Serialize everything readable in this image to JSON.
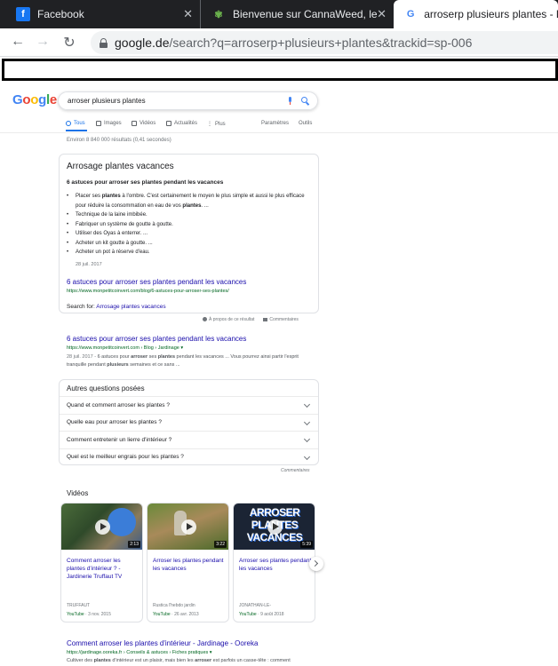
{
  "browser": {
    "tabs": [
      {
        "label": "Facebook",
        "icon": "facebook-icon"
      },
      {
        "label": "Bienvenue sur CannaWeed, le site",
        "icon": "cannabis-leaf-icon"
      },
      {
        "label": "arroserp plusieurs plantes - Rec",
        "icon": "google-icon"
      }
    ],
    "url_domain": "google.de",
    "url_path": "/search?q=arroserp+plusieurs+plantes&trackid=sp-006"
  },
  "google": {
    "logo_letters": [
      "G",
      "o",
      "o",
      "g",
      "l",
      "e"
    ],
    "query": "arroser plusieurs plantes",
    "tabs": [
      "Tous",
      "Images",
      "Vidéos",
      "Actualités",
      "Plus",
      "Paramètres",
      "Outils"
    ],
    "stats": "Environ 8 840 000 résultats (0,41 secondes)"
  },
  "snippet": {
    "title": "Arrosage plantes vacances",
    "heading": "6 astuces pour arroser ses plantes pendant les vacances",
    "items": [
      {
        "pre": "Placer ses ",
        "b1": "plantes",
        "mid": " à l'ombre. C'est certainement le moyen le plus simple et aussi le plus efficace pour réduire la consommation en eau de vos ",
        "b2": "plantes",
        "post": ". ..."
      },
      {
        "text": "Technique de la laine imbibée."
      },
      {
        "text": "Fabriquer un système de goutte à goutte."
      },
      {
        "text": "Utiliser des Oyas à enterrer. ..."
      },
      {
        "text": "Acheter un kit goutte à goutte. ..."
      },
      {
        "text": "Acheter un pot à réserve d'eau."
      }
    ],
    "date": "28 juil. 2017",
    "link": "6 astuces pour arroser ses plantes pendant les vacances",
    "url": "https://www.monpetitcoinvert.com/blog/6-astuces-pour-arroser-ses-plantes/",
    "search_for_label": "Search for: ",
    "search_for_link": "Arrosage plantes vacances",
    "about": "À propos de ce résultat",
    "comments": "Commentaires"
  },
  "result1": {
    "title": "6 astuces pour arroser ses plantes pendant les vacances",
    "url": "https://www.monpetitcoinvert.com › Blog › Jardinage ▾",
    "date": "28 juil. 2017 - ",
    "s1": "6 astuces pour ",
    "b1": "arroser",
    "s2": " ses ",
    "b2": "plantes",
    "s3": " pendant les vacances ... Vous pourrez ainsi partir l'esprit tranquille pendant ",
    "b3": "plusieurs",
    "s4": " semaines et ce sans ..."
  },
  "paa": {
    "title": "Autres questions posées",
    "questions": [
      "Quand et comment arroser les plantes ?",
      "Quelle eau pour arroser les plantes ?",
      "Comment entretenir un lierre d'intérieur ?",
      "Quel est le meilleur engrais pour les plantes ?"
    ],
    "footer": "Commentaires"
  },
  "videos": {
    "heading": "Vidéos",
    "items": [
      {
        "title": "Comment arroser les plantes d'intérieur ? - Jardinerie Truffaut TV",
        "duration": "2:13",
        "channel": "TRUFFAUT",
        "source": "YouTube",
        "date": " · 3 nov. 2015"
      },
      {
        "title": "Arroser les plantes pendant les vacances",
        "duration": "3:22",
        "channel": "Rustica l'hebdo jardin",
        "source": "YouTube",
        "date": " · 26 avr. 2013"
      },
      {
        "title": "Arroser ses plantes pendant les vacances",
        "duration": "5:39",
        "channel": "JONATHAN-LE-",
        "source": "YouTube",
        "date": " · 9 août 2018",
        "thumb_text": [
          "ARROSER",
          "PLANTES",
          "VACANCES"
        ]
      }
    ]
  },
  "result2": {
    "title": "Comment arroser les plantes d'intérieur - Jardinage - Ooreka",
    "url": "https://jardinage.ooreka.fr › Conseils & astuces › Fiches pratiques ▾",
    "s1": "Cultiver des ",
    "b1": "plantes",
    "s2": " d'intérieur est un plaisir, mais bien les ",
    "b2": "arroser",
    "s3": " est parfois un casse-tête : comment"
  }
}
